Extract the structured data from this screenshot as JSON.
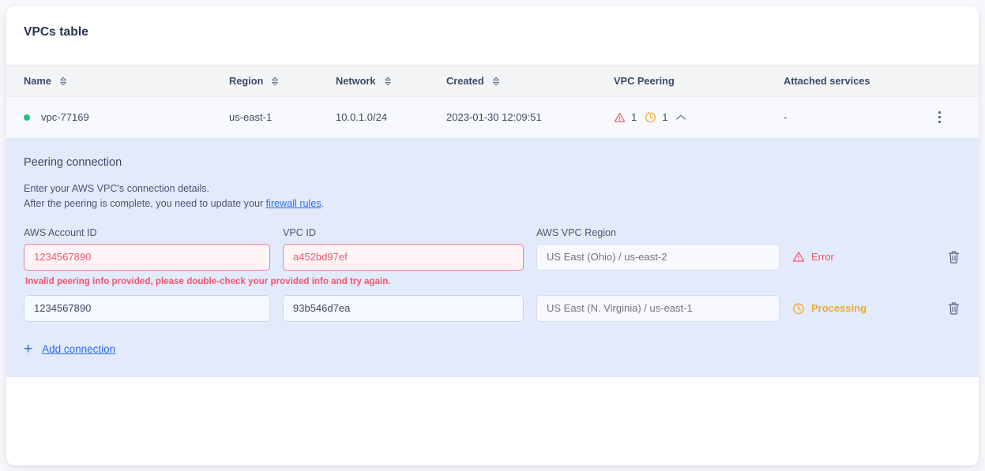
{
  "card": {
    "title": "VPCs table"
  },
  "table": {
    "columns": [
      {
        "label": "Name",
        "sortable": true
      },
      {
        "label": "Region",
        "sortable": true
      },
      {
        "label": "Network",
        "sortable": true
      },
      {
        "label": "Created",
        "sortable": true
      },
      {
        "label": "VPC Peering",
        "sortable": false
      },
      {
        "label": "Attached services",
        "sortable": false
      }
    ],
    "rows": [
      {
        "status_color": "#1bc47d",
        "name": "vpc-77169",
        "region": "us-east-1",
        "network": "10.0.1.0/24",
        "created": "2023-01-30 12:09:51",
        "peering_error_count": "1",
        "peering_processing_count": "1",
        "attached_services": "-",
        "expanded": true
      }
    ]
  },
  "panel": {
    "heading": "Peering connection",
    "desc_line1": "Enter your AWS VPC's connection details.",
    "desc_line2_before": "After the peering is complete, you need to update your ",
    "desc_link": "firewall rules",
    "desc_line2_after": ".",
    "labels": {
      "account_id": "AWS Account ID",
      "vpc_id": "VPC ID",
      "region": "AWS VPC Region"
    },
    "connections": [
      {
        "account_id": "1234567890",
        "vpc_id": "a452bd97ef",
        "region_placeholder": "US East (Ohio) / us-east-2",
        "region_value": "",
        "status": "Error",
        "state": "error",
        "error_message": "Invalid peering info provided, please double-check your provided info and try again."
      },
      {
        "account_id": "1234567890",
        "vpc_id": "93b546d7ea",
        "region_placeholder": "US East (N. Virginia) / us-east-1",
        "region_value": "",
        "status": "Processing",
        "state": "processing",
        "error_message": ""
      }
    ],
    "add_connection": "Add connection",
    "add_icon": "+"
  },
  "colors": {
    "accent_link": "#2b6cf0",
    "error": "#f2566e",
    "processing": "#f0a92c",
    "status_ok": "#1bc47d",
    "panel_bg": "#e3eafc"
  }
}
